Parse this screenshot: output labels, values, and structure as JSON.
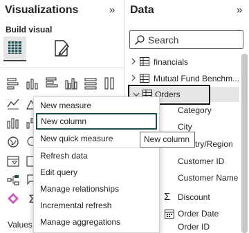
{
  "visualizations": {
    "title": "Visualizations",
    "collapse_icon": "double-chevron-right-icon",
    "build_label": "Build visual",
    "values_label": "Values"
  },
  "data": {
    "title": "Data",
    "collapse_icon": "double-chevron-right-icon",
    "search_placeholder": "Search",
    "tables": [
      {
        "label": "financials",
        "expanded": false
      },
      {
        "label": "Mutual Fund Benchm...",
        "expanded": false
      },
      {
        "label": "Orders",
        "expanded": true
      }
    ],
    "fields": [
      {
        "label": "Category",
        "icon": ""
      },
      {
        "label": "City",
        "icon": ""
      },
      {
        "label": "Country/Region",
        "visible_text": "try/Region",
        "icon": ""
      },
      {
        "label": "Customer ID",
        "icon": ""
      },
      {
        "label": "Customer Name",
        "icon": ""
      },
      {
        "label": "Discount",
        "icon": "sigma-icon"
      },
      {
        "label": "Order Date",
        "icon": "calendar-icon"
      },
      {
        "label": "Order ID",
        "icon": ""
      }
    ]
  },
  "context_menu": {
    "items": [
      {
        "label": "New measure"
      },
      {
        "label": "New column",
        "selected": true
      },
      {
        "label": "New quick measure"
      },
      {
        "label": "Refresh data"
      },
      {
        "label": "Edit query"
      },
      {
        "label": "Manage relationships"
      },
      {
        "label": "Incremental refresh"
      },
      {
        "label": "Manage aggregations"
      }
    ]
  },
  "tooltip": {
    "text": "New column"
  },
  "colors": {
    "selected_border": "#1e4e4f",
    "highlight_border": "#111111",
    "row_selected_bg": "#e6e6e6"
  }
}
